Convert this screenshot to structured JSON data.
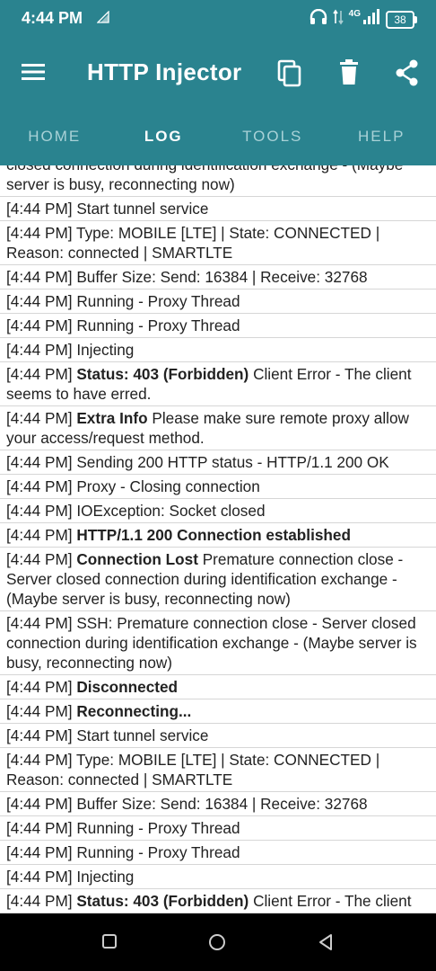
{
  "status_bar": {
    "time": "4:44 PM",
    "battery": "38",
    "network_type": "4G",
    "icons": [
      "signal-small-icon",
      "headphones-icon",
      "data-arrows-icon",
      "lte-signal-icon",
      "battery-icon"
    ]
  },
  "app_bar": {
    "title": "HTTP Injector",
    "actions": [
      "menu-icon",
      "copy-icon",
      "delete-icon",
      "share-icon"
    ]
  },
  "tabs": [
    {
      "label": "HOME",
      "active": false
    },
    {
      "label": "LOG",
      "active": true
    },
    {
      "label": "TOOLS",
      "active": false
    },
    {
      "label": "HELP",
      "active": false
    }
  ],
  "log": [
    {
      "time": "",
      "bold": "",
      "text": "closed connection during identification exchange - (Maybe server is busy, reconnecting now)"
    },
    {
      "time": "[4:44 PM]",
      "bold": "",
      "text": "Start tunnel service"
    },
    {
      "time": "[4:44 PM]",
      "bold": "",
      "text": "Type: MOBILE [LTE] | State: CONNECTED | Reason: connected | SMARTLTE"
    },
    {
      "time": "[4:44 PM]",
      "bold": "",
      "text": "Buffer Size: Send: 16384 | Receive: 32768"
    },
    {
      "time": "[4:44 PM]",
      "bold": "",
      "text": "Running - Proxy Thread"
    },
    {
      "time": "[4:44 PM]",
      "bold": "",
      "text": "Running - Proxy Thread"
    },
    {
      "time": "[4:44 PM]",
      "bold": "",
      "text": "Injecting"
    },
    {
      "time": "[4:44 PM]",
      "bold": "Status: 403 (Forbidden)",
      "text": "Client Error - The client seems to have erred."
    },
    {
      "time": "[4:44 PM]",
      "bold": "Extra Info",
      "text": "Please make sure remote proxy allow your access/request method."
    },
    {
      "time": "[4:44 PM]",
      "bold": "",
      "text": "Sending 200 HTTP status - HTTP/1.1 200 OK"
    },
    {
      "time": "[4:44 PM]",
      "bold": "",
      "text": "Proxy - Closing connection"
    },
    {
      "time": "[4:44 PM]",
      "bold": "",
      "text": "IOException: Socket closed"
    },
    {
      "time": "[4:44 PM]",
      "bold": "HTTP/1.1 200 Connection established",
      "text": ""
    },
    {
      "time": "[4:44 PM]",
      "bold": "Connection Lost",
      "text": "Premature connection close - Server closed connection during identification exchange - (Maybe server is busy, reconnecting now)"
    },
    {
      "time": "[4:44 PM]",
      "bold": "",
      "text": "SSH: Premature connection close - Server closed connection during identification exchange - (Maybe server is busy, reconnecting now)"
    },
    {
      "time": "[4:44 PM]",
      "bold": "Disconnected",
      "text": ""
    },
    {
      "time": "[4:44 PM]",
      "bold": "Reconnecting...",
      "text": ""
    },
    {
      "time": "[4:44 PM]",
      "bold": "",
      "text": "Start tunnel service"
    },
    {
      "time": "[4:44 PM]",
      "bold": "",
      "text": "Type: MOBILE [LTE] | State: CONNECTED | Reason: connected | SMARTLTE"
    },
    {
      "time": "[4:44 PM]",
      "bold": "",
      "text": "Buffer Size: Send: 16384 | Receive: 32768"
    },
    {
      "time": "[4:44 PM]",
      "bold": "",
      "text": "Running - Proxy Thread"
    },
    {
      "time": "[4:44 PM]",
      "bold": "",
      "text": "Running - Proxy Thread"
    },
    {
      "time": "[4:44 PM]",
      "bold": "",
      "text": "Injecting"
    },
    {
      "time": "[4:44 PM]",
      "bold": "Status: 403 (Forbidden)",
      "text": "Client Error - The client"
    }
  ],
  "nav_bar": [
    "recents-square-icon",
    "home-circle-icon",
    "back-triangle-icon"
  ]
}
